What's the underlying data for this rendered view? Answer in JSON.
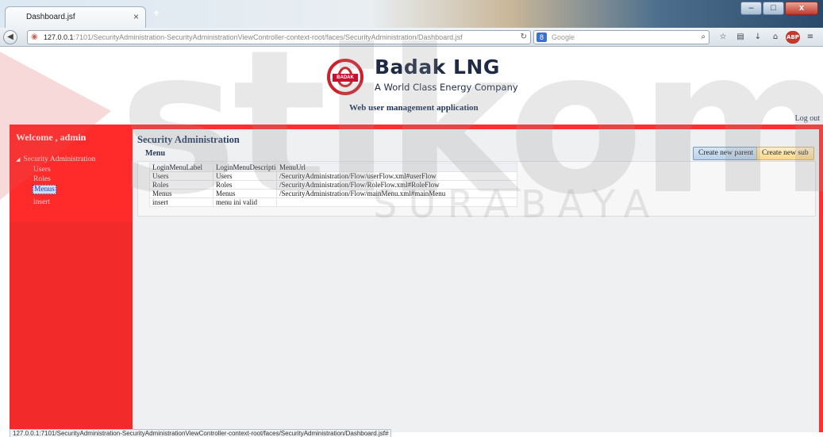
{
  "browser": {
    "tab_title": "Dashboard.jsf",
    "tab_close": "×",
    "new_tab": "+",
    "url_host": "127.0.0.1",
    "url_rest": ":7101/SecurityAdministration-SecurityAdministrationViewController-context-root/faces/SecurityAdministration/Dashboard.jsf",
    "search_placeholder": "Google",
    "window_minimize": "–",
    "window_maximize": "□",
    "window_close": "x",
    "status_url": "127.0.0.1:7101/SecurityAdministration-SecurityAdministrationViewController-context-root/faces/SecurityAdministration/Dashboard.jsf#"
  },
  "header": {
    "brand_name": "Badak LNG",
    "brand_tagline": "A World Class Energy Company",
    "logo_badge": "BADAK",
    "app_title": "Web user management application",
    "logout": "Log out"
  },
  "sidebar": {
    "welcome": "Welcome , admin",
    "root_label": "Security Administration",
    "items": [
      {
        "label": "Users"
      },
      {
        "label": "Roles"
      },
      {
        "label": "Menus",
        "selected": true
      },
      {
        "label": "insert"
      }
    ]
  },
  "main": {
    "title": "Security Administration",
    "panel_title": "Menu",
    "create_parent": "Create new parent",
    "create_sub": "Create new sub",
    "columns": [
      "LoginMenuLabel",
      "LoginMenuDescription",
      "MenuUrl"
    ],
    "rows": [
      [
        "Users",
        "Users",
        "/SecurityAdministration/Flow/userFlow.xml#userFlow"
      ],
      [
        "Roles",
        "Roles",
        "/SecurityAdministration/Flow/RoleFlow.xml#RoleFlow"
      ],
      [
        "Menus",
        "Menus",
        "/SecurityAdministration/Flow/mainMenu.xml#mainMenu"
      ],
      [
        "insert",
        "menu ini valid",
        ""
      ]
    ]
  },
  "watermark": {
    "big": "stikom",
    "sub": "SURABAYA"
  },
  "colors": {
    "sidebar": "#ff2b2b",
    "frame": "#ff2f2f",
    "content_bg": "#eff0f2",
    "brand": "#1f2a44",
    "logo_red": "#d11f2a"
  }
}
